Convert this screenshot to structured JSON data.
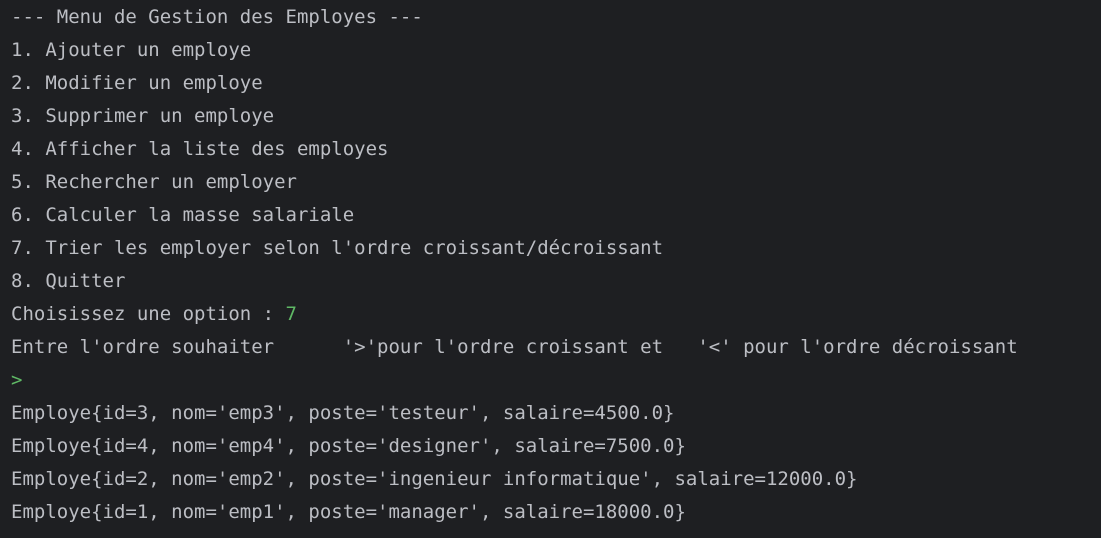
{
  "colors": {
    "background": "#1e1f22",
    "text": "#bcbec4",
    "user_input": "#5fb865"
  },
  "console": {
    "menu_title": "--- Menu de Gestion des Employes ---",
    "menu_items": [
      "1. Ajouter un employe",
      "2. Modifier un employe",
      "3. Supprimer un employe",
      "4. Afficher la liste des employes",
      "5. Rechercher un employer",
      "6. Calculer la masse salariale",
      "7. Trier les employer selon l'ordre croissant/décroissant",
      "8. Quitter"
    ],
    "option_prompt": "Choisissez une option : ",
    "option_input": "7",
    "order_prompt": "Entre l'ordre souhaiter      '>'pour l'ordre croissant et   '<' pour l'ordre décroissant",
    "order_input": ">",
    "results": [
      "Employe{id=3, nom='emp3', poste='testeur', salaire=4500.0}",
      "Employe{id=4, nom='emp4', poste='designer', salaire=7500.0}",
      "Employe{id=2, nom='emp2', poste='ingenieur informatique', salaire=12000.0}",
      "Employe{id=1, nom='emp1', poste='manager', salaire=18000.0}"
    ]
  }
}
